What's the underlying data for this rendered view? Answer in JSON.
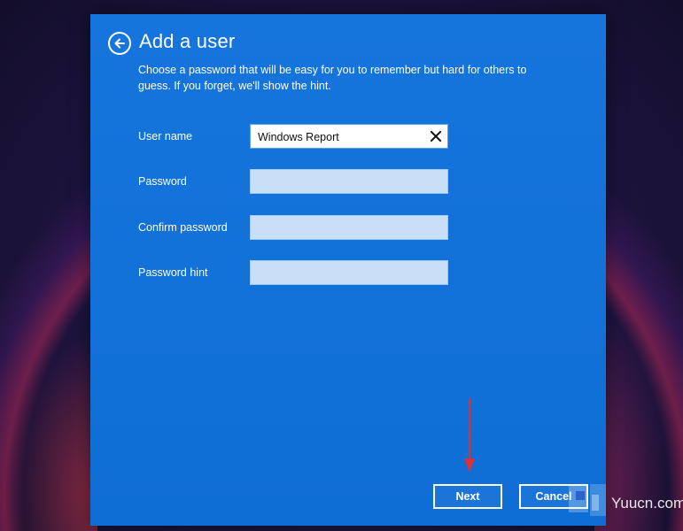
{
  "dialog": {
    "title": "Add a user",
    "subtitle": "Choose a password that will be easy for you to remember but hard for others to guess. If you forget, we'll show the hint."
  },
  "form": {
    "fields": [
      {
        "label": "User name",
        "value": "Windows Report"
      },
      {
        "label": "Password",
        "value": ""
      },
      {
        "label": "Confirm password",
        "value": ""
      },
      {
        "label": "Password hint",
        "value": ""
      }
    ]
  },
  "buttons": {
    "next_label": "Next",
    "cancel_label": "Cancel"
  },
  "annotation": {
    "arrow_color": "#d8323a"
  },
  "watermark": {
    "text": "Yuucn.com"
  },
  "colors": {
    "dialog_background": "#1675dc",
    "field_background": "#c7e0f7"
  }
}
